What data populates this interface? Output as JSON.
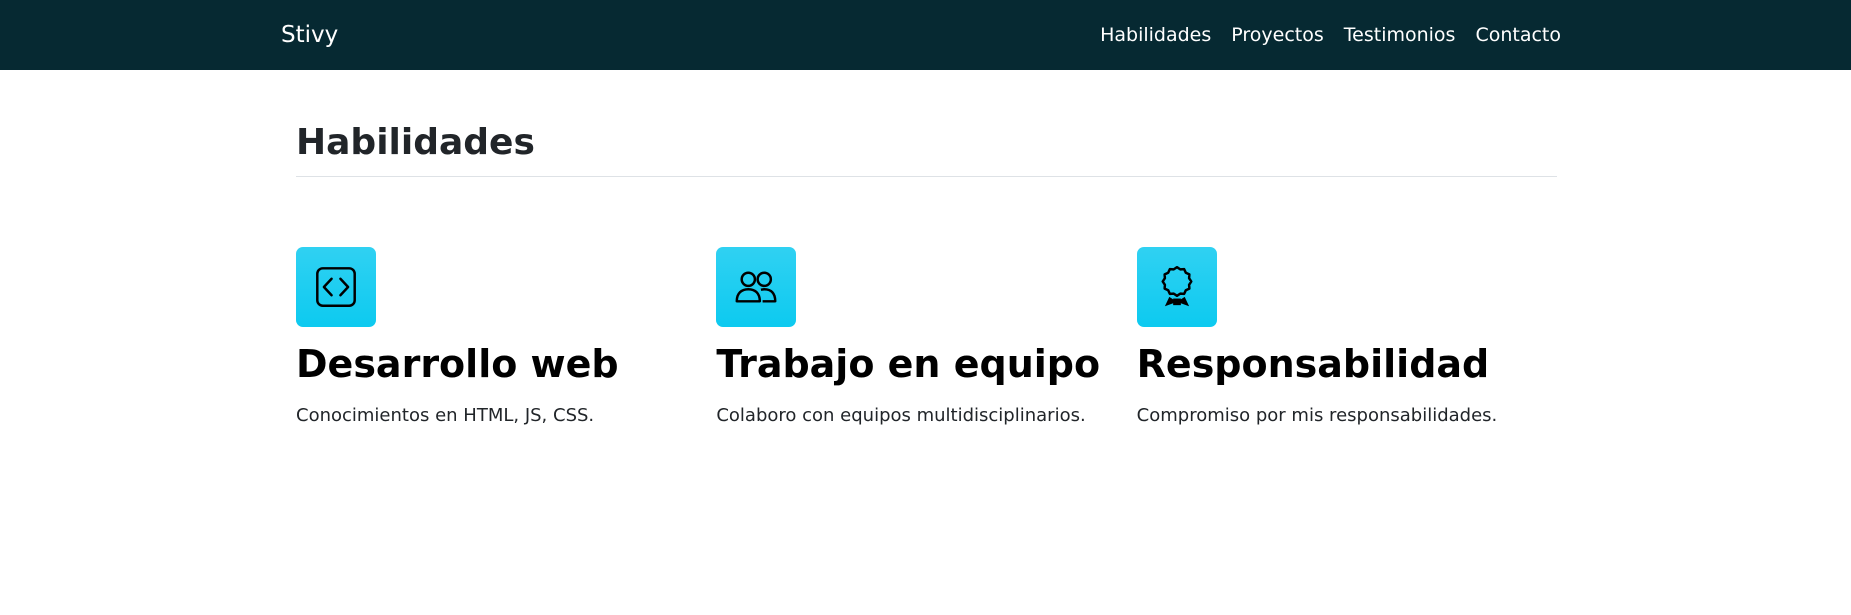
{
  "navbar": {
    "brand": "Stivy",
    "links": [
      "Habilidades",
      "Proyectos",
      "Testimonios",
      "Contacto"
    ]
  },
  "skills": {
    "title": "Habilidades",
    "items": [
      {
        "icon": "code-square-icon",
        "title": "Desarrollo web",
        "text": "Conocimientos en HTML, JS, CSS."
      },
      {
        "icon": "people-icon",
        "title": "Trabajo en equipo",
        "text": "Colaboro con equipos multidisciplinarios."
      },
      {
        "icon": "award-icon",
        "title": "Responsabilidad",
        "text": "Compromiso por mis responsabilidades."
      }
    ]
  },
  "colors": {
    "navbar_bg": "#062932",
    "icon_bg": "#0dcaf0",
    "divider": "#dee2e6"
  }
}
